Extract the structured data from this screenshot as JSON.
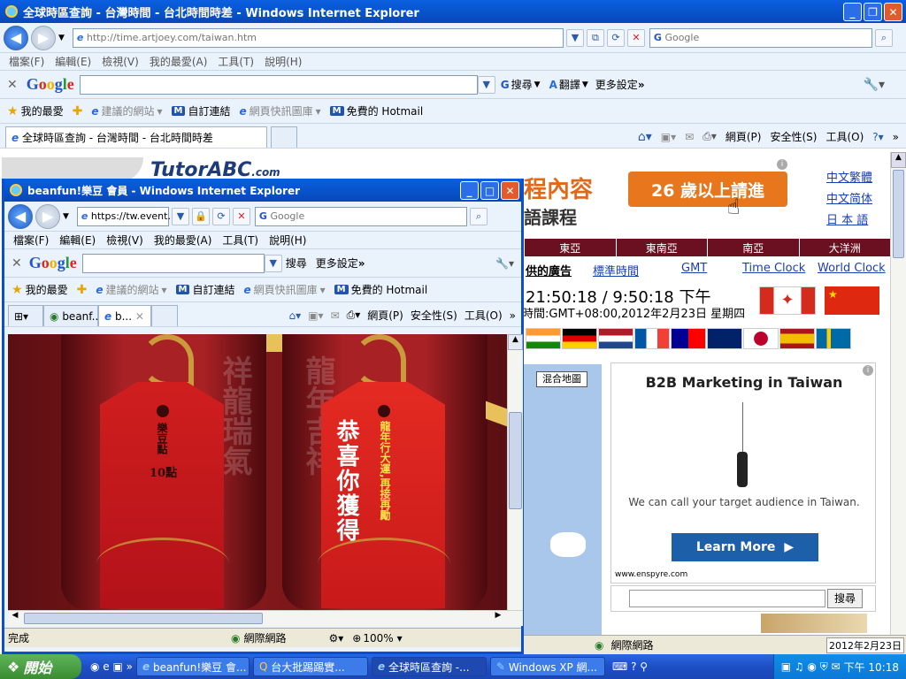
{
  "main": {
    "title": "全球時區查詢 - 台灣時間 - 台北時間時差 - Windows Internet Explorer",
    "address": "http://time.artjoey.com/taiwan.htm",
    "search_placeholder": "Google",
    "menu": [
      "檔案(F)",
      "編輯(E)",
      "檢視(V)",
      "我的最愛(A)",
      "工具(T)",
      "說明(H)"
    ],
    "google_toolbar": {
      "search": "搜尋",
      "translate": "翻譯",
      "more": "更多設定"
    },
    "favorites": {
      "label": "我的最愛",
      "items": [
        "建議的網站",
        "自訂連結",
        "網頁快訊圖庫",
        "免費的 Hotmail"
      ]
    },
    "tab_title": "全球時區查詢 - 台灣時間 - 台北時間時差",
    "command_bar": {
      "page": "網頁(P)",
      "safety": "安全性(S)",
      "tools": "工具(O)"
    },
    "page": {
      "tutor_brand": "TutorABC",
      "tutor_com": ".com",
      "course_line1": "程內容",
      "course_line2": "語課程",
      "promo": "26 歲以上請進",
      "lang_links": [
        "中文繁體",
        "中文简体",
        "日 本 語"
      ],
      "regions": [
        "東亞",
        "東南亞",
        "南亞",
        "大洋洲"
      ],
      "ads_label": "供的廣告",
      "time_links": [
        "標準時間",
        "GMT",
        "Time Clock",
        "World Clock"
      ],
      "clock_time": "21:50:18 / 9:50:18 下午",
      "clock_date": "時間:GMT+08:00,2012年2月23日 星期四",
      "map_button": "混合地圖",
      "ad": {
        "title": "B2B Marketing in Taiwan",
        "text": "We can call your target audience in Taiwan.",
        "button": "Learn More",
        "url": "www.enspyre.com"
      },
      "search_button": "搜尋"
    },
    "status": {
      "zone": "網際網路"
    }
  },
  "popup": {
    "title": "beanfun!樂豆 會員 - Windows Internet Explorer",
    "address": "https://tw.event.b",
    "search_placeholder": "Google",
    "menu": [
      "檔案(F)",
      "編輯(E)",
      "檢視(V)",
      "我的最愛(A)",
      "工具(T)",
      "說明(H)"
    ],
    "google_toolbar": {
      "search": "搜尋",
      "more": "更多設定"
    },
    "favorites": {
      "label": "我的最愛",
      "items": [
        "建議的網站",
        "自訂連結",
        "網頁快訊圖庫",
        "免費的 Hotmail"
      ]
    },
    "tabs": [
      "beanf...",
      "b..."
    ],
    "command_bar": {
      "page": "網頁(P)",
      "safety": "安全性(S)",
      "tools": "工具(O)"
    },
    "tag1": {
      "text": "樂豆點",
      "points": "10點"
    },
    "tag2": {
      "main": "恭喜你獲得",
      "sub": "龍年行大運,再接再勵"
    },
    "bg_text_left": "祥龍瑞氣",
    "bg_text_right": "龍年吉祥",
    "status": {
      "done": "完成",
      "zone": "網際網路",
      "zoom": "100%"
    }
  },
  "taskbar": {
    "start": "開始",
    "items": [
      "beanfun!樂豆 會...",
      "台大批踢踢實...",
      "全球時區查詢 -...",
      "Windows XP 網..."
    ],
    "clock": "下午 10:18",
    "date_tip": "2012年2月23日"
  }
}
